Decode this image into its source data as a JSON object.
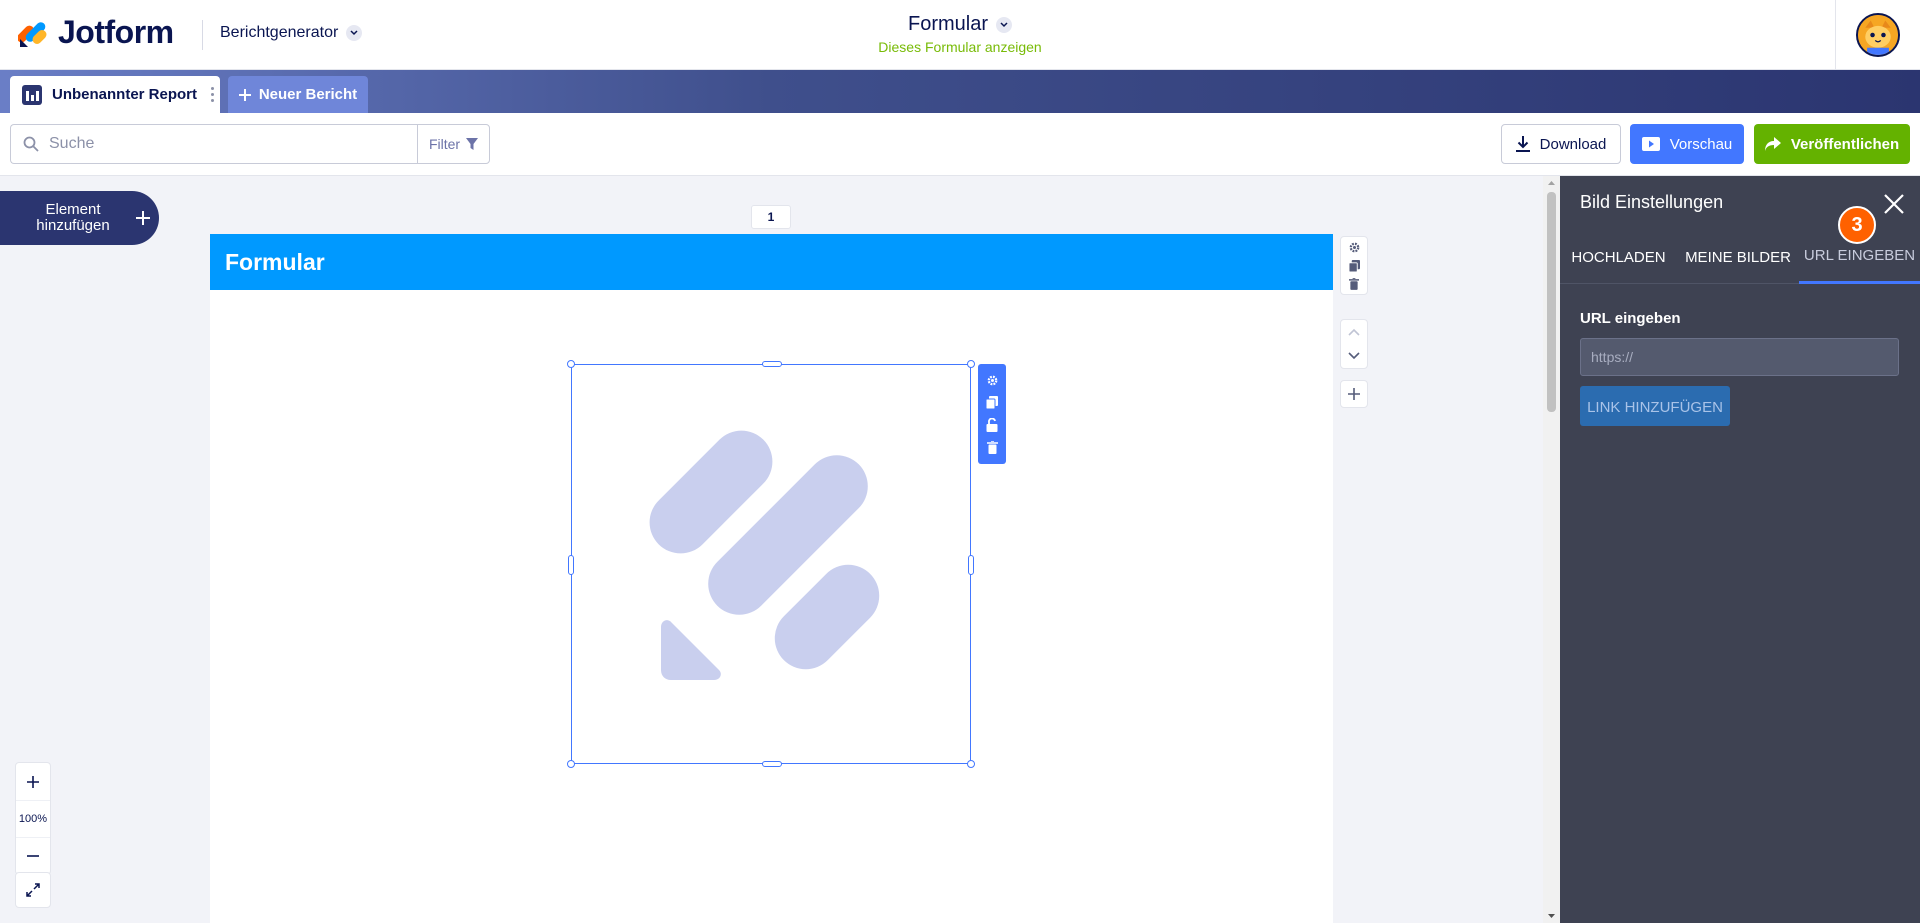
{
  "header": {
    "brand": "Jotform",
    "app_name": "Berichtgenerator",
    "form_title": "Formular",
    "form_subtitle": "Dieses Formular anzeigen"
  },
  "tabs": {
    "report_tab": "Unbenannter Report",
    "new_report": "Neuer Bericht"
  },
  "toolbar": {
    "search_placeholder": "Suche",
    "filter_label": "Filter",
    "download_label": "Download",
    "preview_label": "Vorschau",
    "publish_label": "Veröffentlichen"
  },
  "canvas": {
    "add_element_label": "Element hinzufügen",
    "page_number": "1",
    "page_header_title": "Formular",
    "zoom_level": "100%"
  },
  "panel": {
    "title": "Bild Einstellungen",
    "tabs": [
      "HOCHLADEN",
      "MEINE BILDER",
      "URL EINGEBEN"
    ],
    "active_tab_index": 2,
    "step_badge": "3",
    "url_label": "URL eingeben",
    "url_placeholder": "https://",
    "add_link_label": "LINK HINZUFÜGEN"
  },
  "colors": {
    "brand_navy": "#0a1551",
    "accent_blue": "#4277ff",
    "publish_green": "#64b200",
    "page_header_blue": "#0099ff",
    "panel_bg": "#3e4252",
    "badge_orange": "#ff6100",
    "placeholder_logo": "#c9cfee"
  },
  "icons": [
    "search-icon",
    "filter-icon",
    "download-icon",
    "play-icon",
    "share-arrow-icon",
    "plus-icon",
    "gear-icon",
    "copy-icon",
    "lock-icon",
    "trash-icon",
    "chevron-up-icon",
    "chevron-down-icon",
    "close-icon",
    "expand-icon"
  ]
}
